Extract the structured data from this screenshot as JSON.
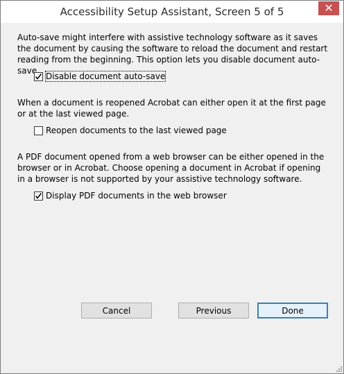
{
  "window": {
    "title": "Accessibility Setup Assistant, Screen 5 of 5",
    "close_symbol": "✕"
  },
  "sections": [
    {
      "text": "Auto-save might interfere with assistive technology software as it saves the document by causing the software to reload the document and restart reading from the beginning. This option lets you disable document auto-save.",
      "checkbox_label": "Disable document auto-save",
      "checked": true
    },
    {
      "text": "When a document is reopened Acrobat can either open it at the first page or at the last viewed page.",
      "checkbox_label": "Reopen documents to the last viewed page",
      "checked": false
    },
    {
      "text": "A PDF document opened from a web browser can be either opened in the browser or in Acrobat. Choose opening a document in Acrobat if opening in a browser is not supported by your assistive technology software.",
      "checkbox_label": "Display PDF documents in the web browser",
      "checked": true
    }
  ],
  "buttons": {
    "cancel": "Cancel",
    "previous": "Previous",
    "done": "Done"
  },
  "icons": {
    "close": "close-icon",
    "check": "checkmark-icon",
    "grip": "resize-grip-icon"
  }
}
